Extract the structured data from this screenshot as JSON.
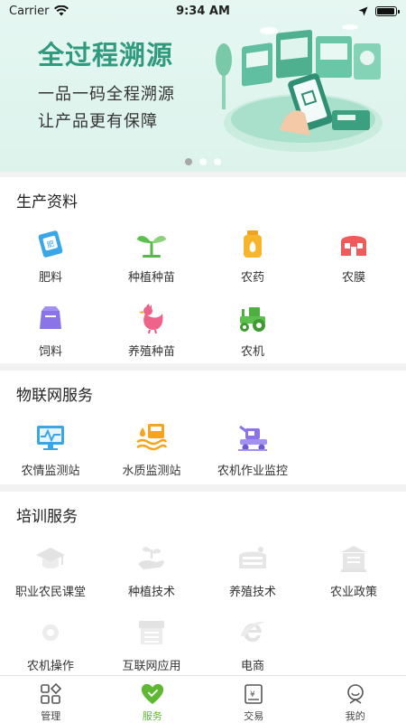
{
  "status_bar": {
    "carrier": "Carrier",
    "time": "9:34 AM",
    "battery_level": 0.95
  },
  "banner": {
    "title": "全过程溯源",
    "line1": "一品一码全程溯源",
    "line2": "让产品更有保障",
    "slides": 3,
    "active_slide": 0,
    "accent_color": "#2f9a7d"
  },
  "sections": {
    "production": {
      "title": "生产资料",
      "items": [
        {
          "label": "肥料",
          "icon": "fertilizer-icon"
        },
        {
          "label": "种植种苗",
          "icon": "seedling-icon"
        },
        {
          "label": "农药",
          "icon": "pesticide-icon"
        },
        {
          "label": "农膜",
          "icon": "greenhouse-film-icon"
        },
        {
          "label": "饲料",
          "icon": "feed-icon"
        },
        {
          "label": "养殖种苗",
          "icon": "chicken-icon"
        },
        {
          "label": "农机",
          "icon": "tractor-icon"
        }
      ]
    },
    "iot": {
      "title": "物联网服务",
      "items": [
        {
          "label": "农情监测站",
          "icon": "monitor-icon"
        },
        {
          "label": "水质监测站",
          "icon": "water-quality-icon"
        },
        {
          "label": "农机作业监控",
          "icon": "harvester-icon"
        }
      ]
    },
    "training": {
      "title": "培训服务",
      "items": [
        {
          "label": "职业农民课堂",
          "icon": "graduation-cap-icon"
        },
        {
          "label": "种植技术",
          "icon": "planting-hand-icon"
        },
        {
          "label": "养殖技术",
          "icon": "breeding-icon"
        },
        {
          "label": "农业政策",
          "icon": "policy-icon"
        },
        {
          "label": "农机操作",
          "icon": "gear-icon"
        },
        {
          "label": "互联网应用",
          "icon": "storefront-icon"
        },
        {
          "label": "电商",
          "icon": "e-commerce-icon"
        }
      ]
    }
  },
  "tabbar": {
    "active": "服务",
    "active_color": "#5fb832",
    "items": [
      {
        "label": "管理",
        "icon": "grid-manage-icon"
      },
      {
        "label": "服务",
        "icon": "heart-icon"
      },
      {
        "label": "交易",
        "icon": "yuan-ticket-icon"
      },
      {
        "label": "我的",
        "icon": "profile-icon"
      }
    ]
  }
}
